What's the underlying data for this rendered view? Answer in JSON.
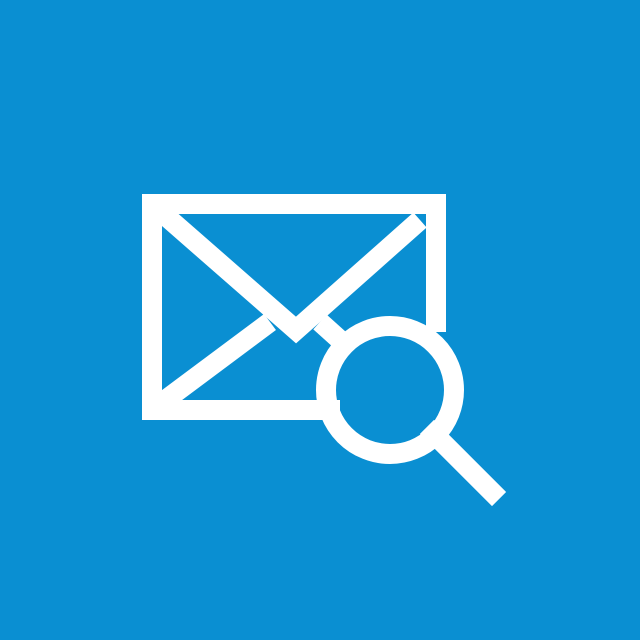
{
  "app": {
    "background_color": "#0a8fd2",
    "icon_color": "#ffffff"
  },
  "icons": {
    "primary": "envelope-icon",
    "overlay": "magnifying-glass-icon"
  }
}
